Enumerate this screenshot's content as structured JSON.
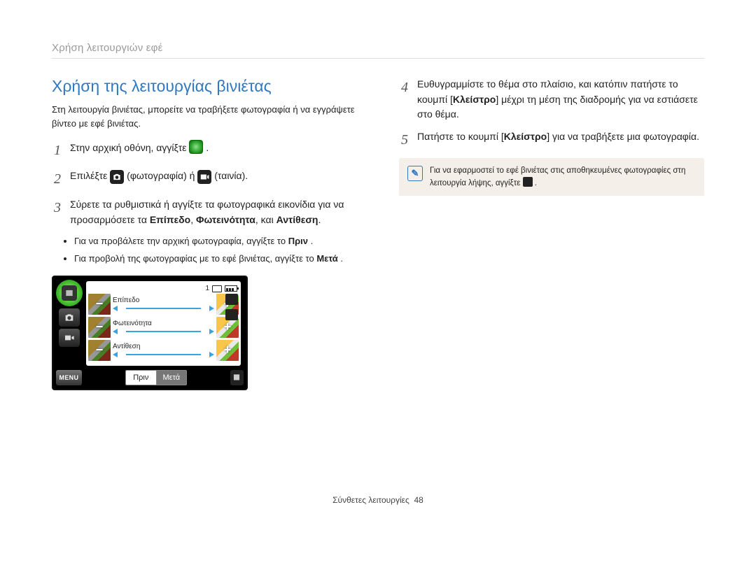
{
  "header": "Χρήση λειτουργιών εφέ",
  "section_title": "Χρήση της λειτουργίας βινιέτας",
  "intro": "Στη λειτουργία βινιέτας, μπορείτε να τραβήξετε φωτογραφία ή να εγγράψετε βίντεο με εφέ βινιέτας.",
  "steps": {
    "s1_pre": "Στην αρχική οθόνη, αγγίξτε ",
    "s1_post": ".",
    "s2_pre": "Επιλέξτε ",
    "s2_mid": " (φωτογραφία) ή ",
    "s2_post": " (ταινία).",
    "s3_a": "Σύρετε τα ρυθμιστικά ή αγγίξτε τα φωτογραφικά εικονίδια για να προσαρμόσετε τα ",
    "s3_b1": "Επίπεδο",
    "s3_comma": ", ",
    "s3_b2": "Φωτεινότητα",
    "s3_and": ", και ",
    "s3_b3": "Αντίθεση",
    "s3_dot": ".",
    "s4_a": "Ευθυγραμμίστε το θέμα στο πλαίσιο, και κατόπιν πατήστε το κουμπί [",
    "s4_b": "Κλείστρο",
    "s4_c": "] μέχρι τη μέση της διαδρομής για να εστιάσετε στο θέμα.",
    "s5_a": "Πατήστε το κουμπί [",
    "s5_b": "Κλείστρο",
    "s5_c": "] για να τραβήξετε μια φωτογραφία."
  },
  "bullets": {
    "b1_a": "Για να προβάλετε την αρχική φωτογραφία, αγγίξτε το ",
    "b1_b": "Πριν",
    "b1_c": ".",
    "b2_a": "Για προβολή της φωτογραφίας με το εφέ βινιέτας, αγγίξτε το ",
    "b2_b": "Μετά",
    "b2_c": "."
  },
  "note": {
    "line1": "Για να εφαρμοστεί το εφέ βινιέτας στις αποθηκευμένες φωτογραφίες στη λειτουργία λήψης, αγγίξτε ",
    "line1_end": "."
  },
  "device": {
    "count": "1",
    "labels": {
      "level": "Επίπεδο",
      "brightness": "Φωτεινότητα",
      "contrast": "Αντίθεση"
    },
    "menu": "MENU",
    "before": "Πριν",
    "after": "Μετά"
  },
  "footer": {
    "label": "Σύνθετες λειτουργίες",
    "page": "48"
  },
  "nums": {
    "n1": "1",
    "n2": "2",
    "n3": "3",
    "n4": "4",
    "n5": "5"
  }
}
